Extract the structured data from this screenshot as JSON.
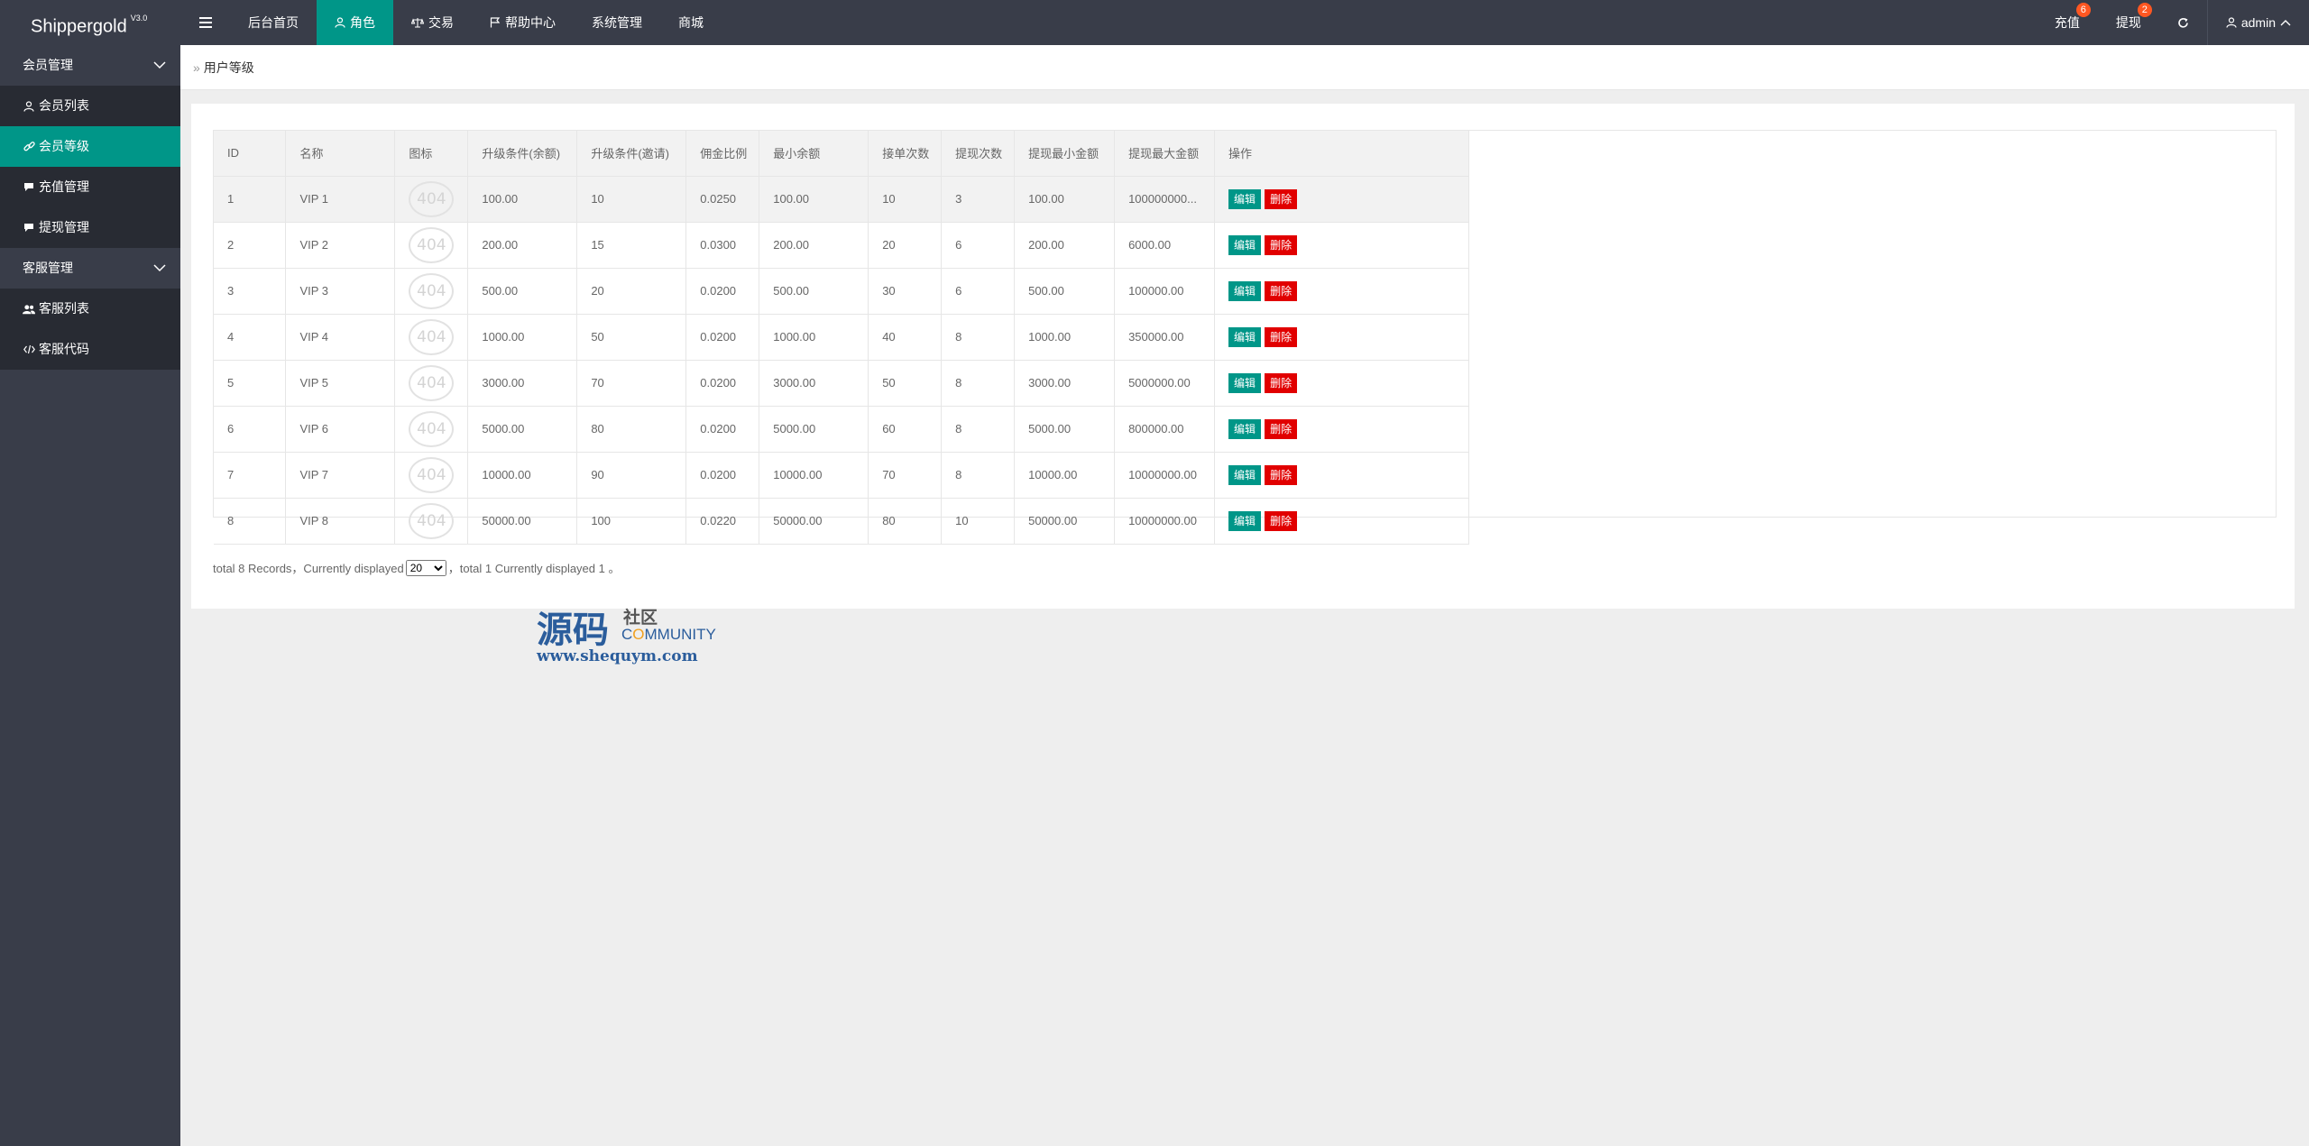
{
  "header": {
    "logo": "Shippergold",
    "version": "V3.0",
    "nav": [
      {
        "label": "后台首页"
      },
      {
        "label": "角色"
      },
      {
        "label": "交易"
      },
      {
        "label": "帮助中心"
      },
      {
        "label": "系统管理"
      },
      {
        "label": "商城"
      }
    ],
    "right": {
      "recharge": {
        "label": "充值",
        "badge": "6"
      },
      "withdraw": {
        "label": "提现",
        "badge": "2"
      },
      "user": "admin"
    }
  },
  "sidebar": {
    "groups": [
      {
        "label": "会员管理",
        "items": [
          {
            "label": "会员列表"
          },
          {
            "label": "会员等级"
          },
          {
            "label": "充值管理"
          },
          {
            "label": "提现管理"
          }
        ]
      },
      {
        "label": "客服管理",
        "items": [
          {
            "label": "客服列表"
          },
          {
            "label": "客服代码"
          }
        ]
      }
    ]
  },
  "breadcrumb": "用户等级",
  "table": {
    "headers": [
      "ID",
      "名称",
      "图标",
      "升级条件(余额)",
      "升级条件(邀请)",
      "佣金比例",
      "最小余额",
      "接单次数",
      "提现次数",
      "提现最小金额",
      "提现最大金额",
      "操作"
    ],
    "icon_placeholder": "404",
    "edit_label": "编辑",
    "delete_label": "删除",
    "rows": [
      [
        "1",
        "VIP 1",
        "100.00",
        "10",
        "0.0250",
        "100.00",
        "10",
        "3",
        "100.00",
        "100000000..."
      ],
      [
        "2",
        "VIP 2",
        "200.00",
        "15",
        "0.0300",
        "200.00",
        "20",
        "6",
        "200.00",
        "6000.00"
      ],
      [
        "3",
        "VIP 3",
        "500.00",
        "20",
        "0.0200",
        "500.00",
        "30",
        "6",
        "500.00",
        "100000.00"
      ],
      [
        "4",
        "VIP 4",
        "1000.00",
        "50",
        "0.0200",
        "1000.00",
        "40",
        "8",
        "1000.00",
        "350000.00"
      ],
      [
        "5",
        "VIP 5",
        "3000.00",
        "70",
        "0.0200",
        "3000.00",
        "50",
        "8",
        "3000.00",
        "5000000.00"
      ],
      [
        "6",
        "VIP 6",
        "5000.00",
        "80",
        "0.0200",
        "5000.00",
        "60",
        "8",
        "5000.00",
        "800000.00"
      ],
      [
        "7",
        "VIP 7",
        "10000.00",
        "90",
        "0.0200",
        "10000.00",
        "70",
        "8",
        "10000.00",
        "10000000.00"
      ],
      [
        "8",
        "VIP 8",
        "50000.00",
        "100",
        "0.0220",
        "50000.00",
        "80",
        "10",
        "50000.00",
        "10000000.00"
      ]
    ]
  },
  "pagination": {
    "prefix": "total 8 Records，Currently displayed",
    "page_size": "20",
    "suffix": "，total 1 Currently displayed 1 。"
  },
  "watermark": {
    "main": "源码",
    "she": "社区",
    "comm_prefix": "C",
    "comm_o": "O",
    "comm_rest": "MMUNITY",
    "url": "www.shequym.com"
  },
  "colors": {
    "accent": "#009688",
    "header": "#393d49",
    "danger": "#e10000",
    "badge": "#ff5722"
  }
}
